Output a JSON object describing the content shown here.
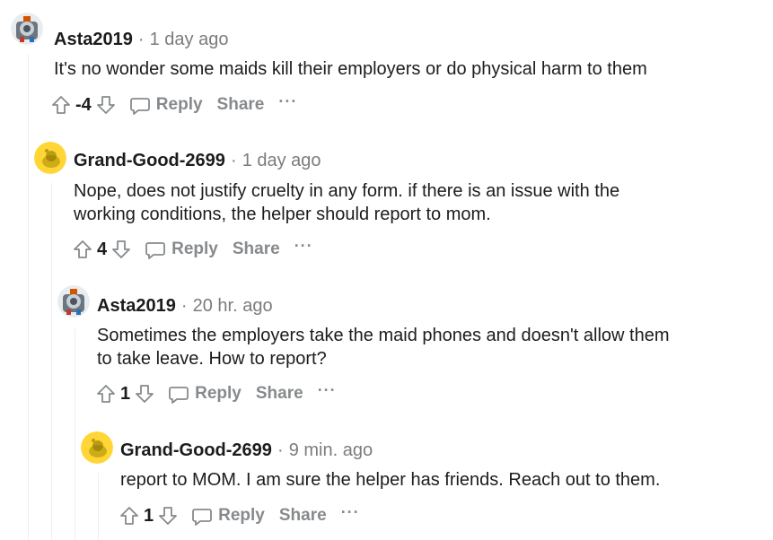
{
  "comments": [
    {
      "author": "Asta2019",
      "time": "1 day ago",
      "lines": [
        "It's no wonder some maids kill their employers or do physical harm to them"
      ],
      "score": "-4",
      "avatar": "robot-snoo-avatar"
    },
    {
      "author": "Grand-Good-2699",
      "time": "1 day ago",
      "lines": [
        "Nope, does not justify cruelty in any form. if there is an issue with the",
        "working conditions, the helper should report to mom."
      ],
      "score": "4",
      "avatar": "default-yellow-snoo-avatar"
    },
    {
      "author": "Asta2019",
      "time": "20 hr. ago",
      "lines": [
        "Sometimes the employers take the maid phones and doesn't allow them",
        "to take leave. How to report?"
      ],
      "score": "1",
      "avatar": "robot-snoo-avatar"
    },
    {
      "author": "Grand-Good-2699",
      "time": "9 min. ago",
      "lines": [
        "report to MOM. I am sure the helper has friends. Reach out to them."
      ],
      "score": "1",
      "avatar": "default-yellow-snoo-avatar"
    }
  ],
  "labels": {
    "reply": "Reply",
    "share": "Share",
    "more": "···",
    "separator": "·"
  },
  "icons": {
    "upvote": "upvote-arrow-icon",
    "downvote": "downvote-arrow-icon",
    "reply": "speech-bubble-icon",
    "more": "ellipsis-icon"
  },
  "colors": {
    "meta": "#7c7c7c",
    "action": "#878a8c",
    "thread_line": "#edeff1",
    "yellow_avatar": "#ffd635"
  }
}
